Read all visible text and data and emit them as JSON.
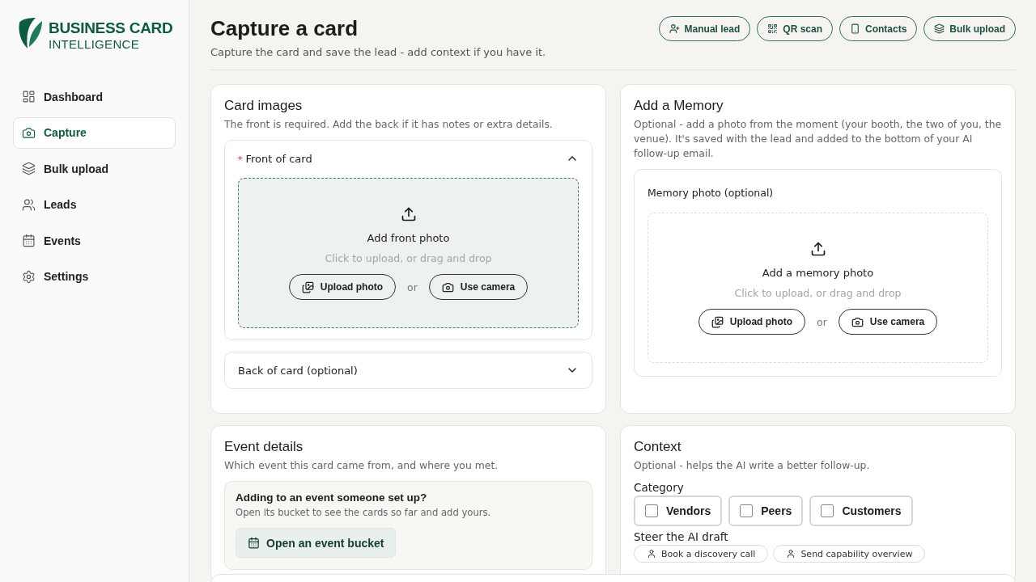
{
  "brand": {
    "name": "BUSINESS CARD",
    "tagline": "INTELLIGENCE"
  },
  "sidebar": {
    "items": [
      {
        "label": "Dashboard",
        "selected": false
      },
      {
        "label": "Capture",
        "selected": true
      },
      {
        "label": "Bulk upload",
        "selected": false
      },
      {
        "label": "Leads",
        "selected": false
      },
      {
        "label": "Events",
        "selected": false
      },
      {
        "label": "Settings",
        "selected": false
      }
    ]
  },
  "header": {
    "title": "Capture a card",
    "subtitle": "Capture the card and save the lead - add context if you have it.",
    "actions": [
      {
        "label": "Manual lead"
      },
      {
        "label": "QR scan"
      },
      {
        "label": "Contacts"
      },
      {
        "label": "Bulk upload"
      }
    ]
  },
  "card_images": {
    "title": "Card images",
    "subtitle": "The front is required. Add the back if it has notes or extra details.",
    "sections": [
      {
        "label": "Front of card",
        "required_mark": "*",
        "expanded": true,
        "dropzone": {
          "title": "Add front photo",
          "hint": "Click to upload, or drag and drop",
          "upload": "Upload photo",
          "or": "or",
          "camera": "Use camera"
        }
      },
      {
        "label": "Back of card (optional)",
        "expanded": false
      }
    ]
  },
  "memory": {
    "title": "Add a Memory",
    "subtitle": "Optional - add a photo from the moment (your booth, the two of you, the venue). It's saved with the lead and added to the bottom of your AI follow-up email.",
    "field_label": "Memory photo (optional)",
    "dropzone": {
      "title": "Add a memory photo",
      "hint": "Click to upload, or drag and drop",
      "upload": "Upload photo",
      "or": "or",
      "camera": "Use camera"
    }
  },
  "event_details": {
    "title": "Event details",
    "subtitle": "Which event this card came from, and where you met.",
    "callout": {
      "title": "Adding to an event someone set up?",
      "text": "Open its bucket to see the cards so far and add yours.",
      "button": "Open an event bucket"
    }
  },
  "context": {
    "title": "Context",
    "subtitle": "Optional - helps the AI write a better follow-up.",
    "category_label": "Category",
    "categories": [
      {
        "label": "Vendors",
        "checked": false
      },
      {
        "label": "Peers",
        "checked": false
      },
      {
        "label": "Customers",
        "checked": false
      }
    ],
    "steer_label": "Steer the AI draft",
    "steer_chips": [
      "Book a discovery call",
      "Send capability overview"
    ]
  }
}
